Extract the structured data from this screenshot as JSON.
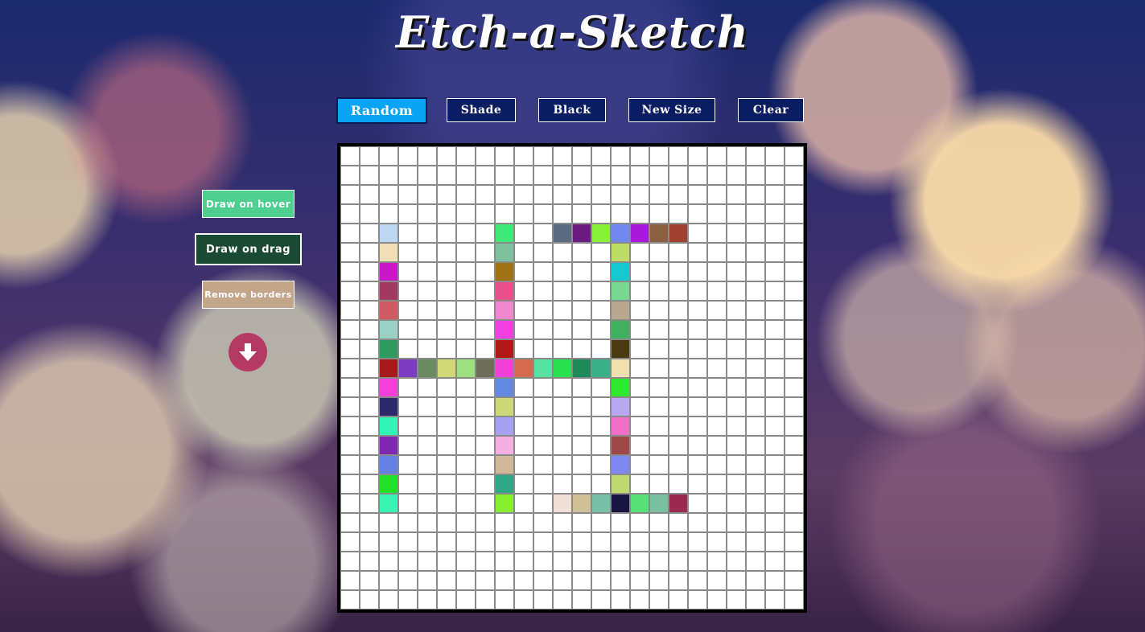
{
  "app": {
    "title": "Etch-a-Sketch"
  },
  "toolbar": {
    "random_label": "Random",
    "shade_label": "Shade",
    "black_label": "Black",
    "new_size_label": "New Size",
    "clear_label": "Clear",
    "active_mode": "Random"
  },
  "side_controls": {
    "draw_on_hover_label": "Draw on hover",
    "draw_on_drag_label": "Draw on drag",
    "remove_borders_label": "Remove borders",
    "scroll_down_icon": "arrow-down-icon"
  },
  "colors": {
    "active_button": "#0aa4f5",
    "button_bg": "#0b1d62",
    "hover_button": "#4fcf8f",
    "drag_button": "#1b4a34",
    "borders_button": "#c3a58a",
    "down_button": "#b53a63"
  },
  "grid": {
    "size": 24,
    "colored_cells": [
      [
        4,
        2,
        "#bcd8f0"
      ],
      [
        5,
        2,
        "#f0dfb6"
      ],
      [
        6,
        2,
        "#c818c8"
      ],
      [
        7,
        2,
        "#a23a60"
      ],
      [
        8,
        2,
        "#d05a62"
      ],
      [
        9,
        2,
        "#9dd0c4"
      ],
      [
        10,
        2,
        "#2e9a60"
      ],
      [
        11,
        2,
        "#a51a1a"
      ],
      [
        12,
        2,
        "#f240d8"
      ],
      [
        13,
        2,
        "#2e2a6a"
      ],
      [
        14,
        2,
        "#2ff5b5"
      ],
      [
        15,
        2,
        "#8028b0"
      ],
      [
        16,
        2,
        "#6580e0"
      ],
      [
        17,
        2,
        "#22e02a"
      ],
      [
        18,
        2,
        "#3af2b2"
      ],
      [
        11,
        3,
        "#7e3cc0"
      ],
      [
        11,
        4,
        "#6a8a62"
      ],
      [
        11,
        5,
        "#d0d878"
      ],
      [
        11,
        6,
        "#9ce080"
      ],
      [
        11,
        7,
        "#6e6e5a"
      ],
      [
        4,
        8,
        "#40e878"
      ],
      [
        5,
        8,
        "#7ec0a0"
      ],
      [
        6,
        8,
        "#a07218"
      ],
      [
        7,
        8,
        "#e8508a"
      ],
      [
        8,
        8,
        "#f088d0"
      ],
      [
        9,
        8,
        "#f240e0"
      ],
      [
        10,
        8,
        "#b01818"
      ],
      [
        11,
        8,
        "#f040d8"
      ],
      [
        12,
        8,
        "#6488e0"
      ],
      [
        13,
        8,
        "#ccd878"
      ],
      [
        14,
        8,
        "#a8a0f0"
      ],
      [
        15,
        8,
        "#f4b0e0"
      ],
      [
        16,
        8,
        "#d0b898"
      ],
      [
        17,
        8,
        "#30a888"
      ],
      [
        18,
        8,
        "#88f030"
      ],
      [
        11,
        9,
        "#d46a50"
      ],
      [
        11,
        10,
        "#58e0a0"
      ],
      [
        11,
        11,
        "#28e050"
      ],
      [
        11,
        12,
        "#1e8a5a"
      ],
      [
        11,
        13,
        "#3ab088"
      ],
      [
        4,
        11,
        "#5a6a80"
      ],
      [
        4,
        12,
        "#6a1a80"
      ],
      [
        4,
        13,
        "#88f038"
      ],
      [
        4,
        14,
        "#7088f0"
      ],
      [
        4,
        15,
        "#a818d8"
      ],
      [
        4,
        16,
        "#8a6040"
      ],
      [
        4,
        17,
        "#a04030"
      ],
      [
        5,
        14,
        "#c0dc68"
      ],
      [
        6,
        14,
        "#18c8d0"
      ],
      [
        7,
        14,
        "#78d890"
      ],
      [
        8,
        14,
        "#b8a890"
      ],
      [
        9,
        14,
        "#40b060"
      ],
      [
        10,
        14,
        "#4a3a10"
      ],
      [
        11,
        14,
        "#f0e0b0"
      ],
      [
        12,
        14,
        "#30e830"
      ],
      [
        13,
        14,
        "#b8a8f0"
      ],
      [
        14,
        14,
        "#f070c8"
      ],
      [
        15,
        14,
        "#a04848"
      ],
      [
        16,
        14,
        "#8088f0"
      ],
      [
        17,
        14,
        "#c0d870"
      ],
      [
        18,
        14,
        "#1a1440"
      ],
      [
        18,
        11,
        "#f0e0d8"
      ],
      [
        18,
        12,
        "#d0c098"
      ],
      [
        18,
        13,
        "#78c0a8"
      ],
      [
        18,
        15,
        "#58e078"
      ],
      [
        18,
        16,
        "#78c0a0"
      ],
      [
        18,
        17,
        "#9a2a50"
      ]
    ]
  }
}
